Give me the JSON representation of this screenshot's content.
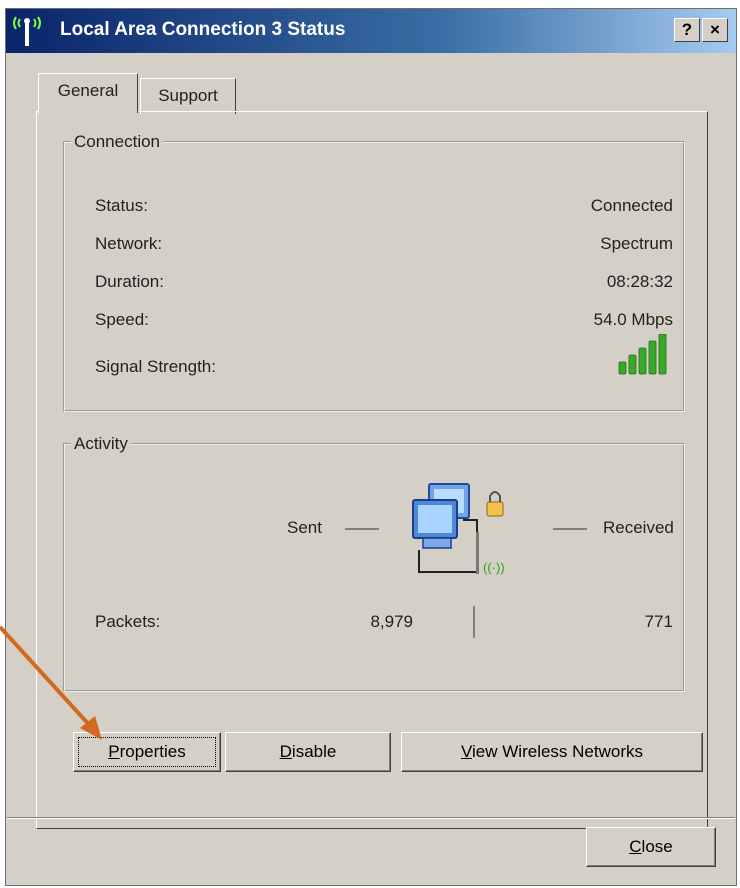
{
  "window": {
    "title": "Local Area Connection 3 Status",
    "help_button": "?",
    "close_button": "×"
  },
  "tabs": [
    {
      "label": "General",
      "active": true
    },
    {
      "label": "Support",
      "active": false
    }
  ],
  "connection": {
    "legend": "Connection",
    "rows": [
      {
        "label": "Status:",
        "value": "Connected"
      },
      {
        "label": "Network:",
        "value": "Spectrum"
      },
      {
        "label": "Duration:",
        "value": "08:28:32"
      },
      {
        "label": "Speed:",
        "value": "54.0 Mbps"
      }
    ],
    "signal_label": "Signal Strength:",
    "signal_icon": "signal-bars-icon",
    "signal_bars_lit": 5,
    "signal_bars_total": 5
  },
  "activity": {
    "legend": "Activity",
    "sent_label": "Sent",
    "received_label": "Received",
    "packets_label": "Packets:",
    "packets_sent": "8,979",
    "packets_received": "771",
    "icon": "network-computers-icon"
  },
  "buttons": {
    "properties": {
      "pre": "",
      "key": "P",
      "post": "roperties"
    },
    "disable": {
      "pre": "",
      "key": "D",
      "post": "isable"
    },
    "view_wireless": {
      "pre": "",
      "key": "V",
      "post": "iew Wireless Networks"
    },
    "close": {
      "pre": "",
      "key": "C",
      "post": "lose"
    }
  },
  "colors": {
    "title_gradient_start": "#0a246a",
    "title_gradient_end": "#a6caf0",
    "dialog_face": "#d4d0c8",
    "signal_green": "#3aa92a",
    "annotation_arrow": "#d2691e"
  }
}
